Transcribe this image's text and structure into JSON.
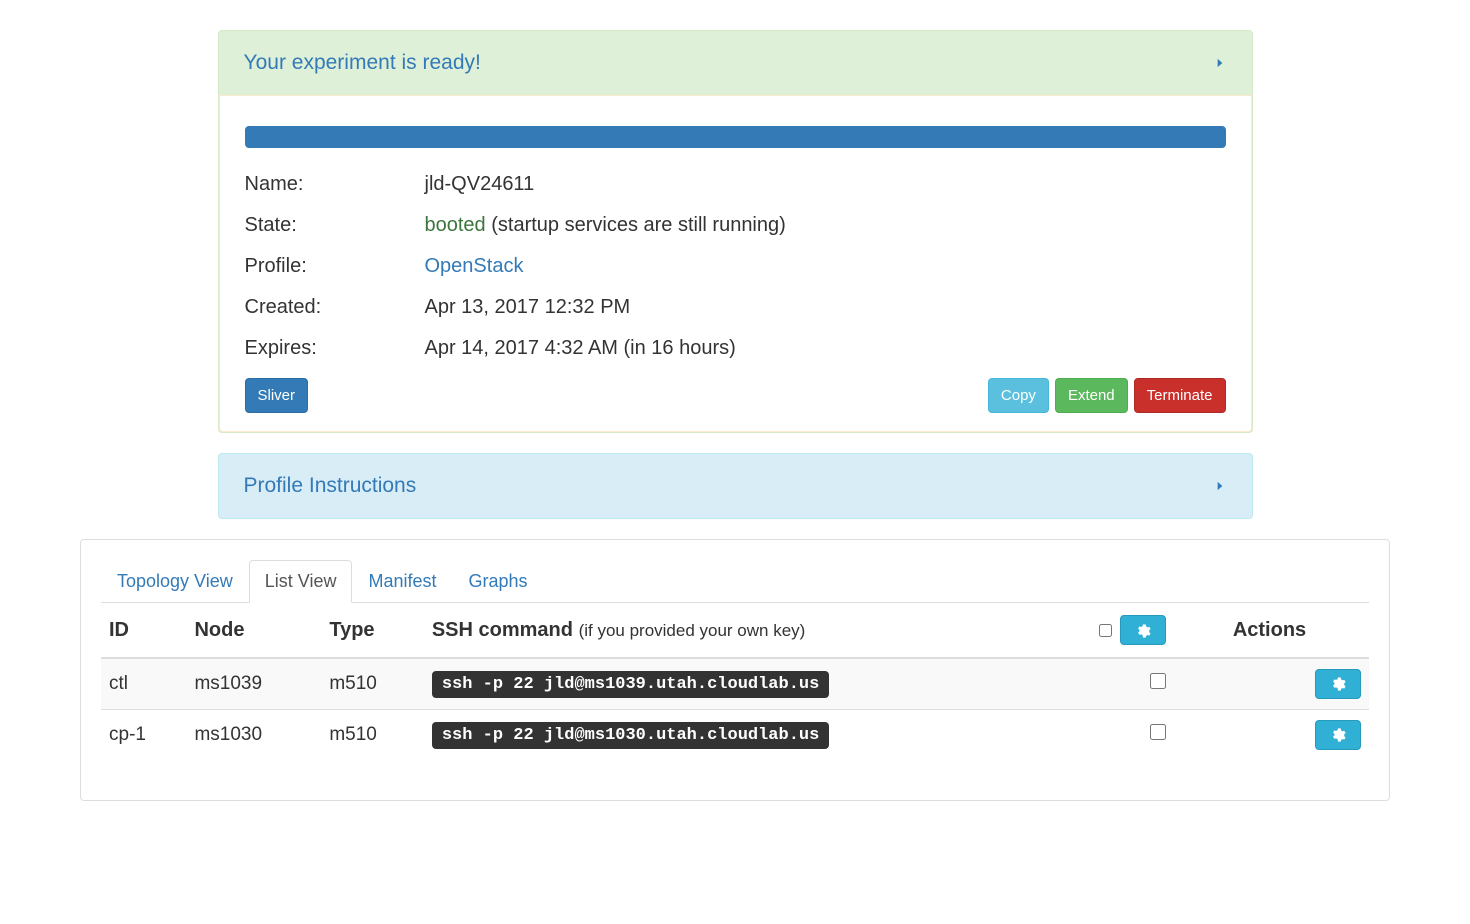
{
  "ready_panel": {
    "title": "Your experiment is ready!"
  },
  "experiment": {
    "name_label": "Name:",
    "name_value": "jld-QV24611",
    "state_label": "State:",
    "state_value": "booted",
    "state_note": "(startup services are still running)",
    "profile_label": "Profile:",
    "profile_value": "OpenStack",
    "created_label": "Created:",
    "created_value": "Apr 13, 2017 12:32 PM",
    "expires_label": "Expires:",
    "expires_value": "Apr 14, 2017 4:32 AM (in 16 hours)"
  },
  "buttons": {
    "sliver": "Sliver",
    "copy": "Copy",
    "extend": "Extend",
    "terminate": "Terminate"
  },
  "instructions_panel": {
    "title": "Profile Instructions"
  },
  "tabs": {
    "topology": "Topology View",
    "list": "List View",
    "manifest": "Manifest",
    "graphs": "Graphs"
  },
  "table": {
    "headers": {
      "id": "ID",
      "node": "Node",
      "type": "Type",
      "ssh": "SSH command",
      "ssh_note": "(if you provided your own key)",
      "actions": "Actions"
    },
    "rows": [
      {
        "id": "ctl",
        "node": "ms1039",
        "type": "m510",
        "ssh": "ssh -p 22 jld@ms1039.utah.cloudlab.us"
      },
      {
        "id": "cp-1",
        "node": "ms1030",
        "type": "m510",
        "ssh": "ssh -p 22 jld@ms1030.utah.cloudlab.us"
      }
    ]
  }
}
